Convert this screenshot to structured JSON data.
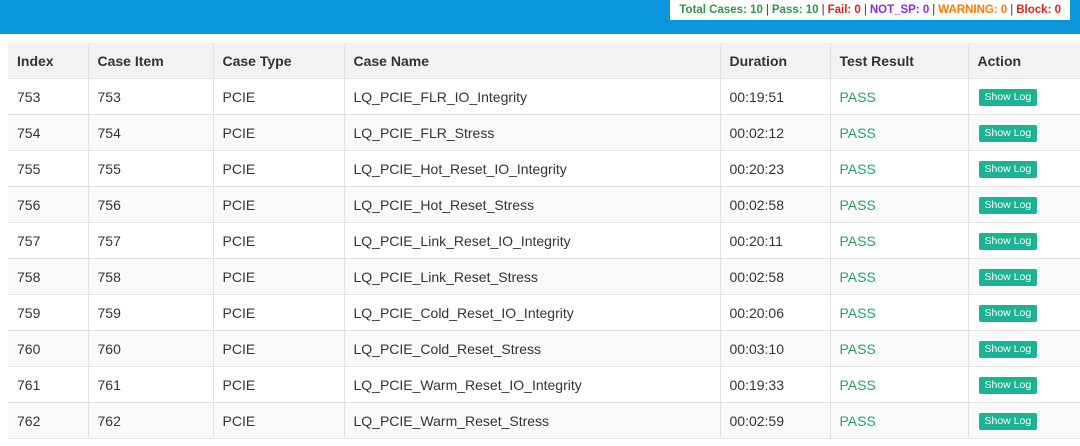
{
  "summary": {
    "total_label": "Total Cases: 10",
    "pass_label": "Pass: 10",
    "fail_label": "Fail: 0",
    "notsp_label": "NOT_SP: 0",
    "warning_label": "WARNING: 0",
    "block_label": "Block: 0",
    "separator": "|"
  },
  "table": {
    "headers": [
      "Index",
      "Case Item",
      "Case Type",
      "Case Name",
      "Duration",
      "Test Result",
      "Action"
    ],
    "rows": [
      {
        "index": "753",
        "case_item": "753",
        "case_type": "PCIE",
        "case_name": "LQ_PCIE_FLR_IO_Integrity",
        "duration": "00:19:51",
        "result": "PASS",
        "action": "Show Log"
      },
      {
        "index": "754",
        "case_item": "754",
        "case_type": "PCIE",
        "case_name": "LQ_PCIE_FLR_Stress",
        "duration": "00:02:12",
        "result": "PASS",
        "action": "Show Log"
      },
      {
        "index": "755",
        "case_item": "755",
        "case_type": "PCIE",
        "case_name": "LQ_PCIE_Hot_Reset_IO_Integrity",
        "duration": "00:20:23",
        "result": "PASS",
        "action": "Show Log"
      },
      {
        "index": "756",
        "case_item": "756",
        "case_type": "PCIE",
        "case_name": "LQ_PCIE_Hot_Reset_Stress",
        "duration": "00:02:58",
        "result": "PASS",
        "action": "Show Log"
      },
      {
        "index": "757",
        "case_item": "757",
        "case_type": "PCIE",
        "case_name": "LQ_PCIE_Link_Reset_IO_Integrity",
        "duration": "00:20:11",
        "result": "PASS",
        "action": "Show Log"
      },
      {
        "index": "758",
        "case_item": "758",
        "case_type": "PCIE",
        "case_name": "LQ_PCIE_Link_Reset_Stress",
        "duration": "00:02:58",
        "result": "PASS",
        "action": "Show Log"
      },
      {
        "index": "759",
        "case_item": "759",
        "case_type": "PCIE",
        "case_name": "LQ_PCIE_Cold_Reset_IO_Integrity",
        "duration": "00:20:06",
        "result": "PASS",
        "action": "Show Log"
      },
      {
        "index": "760",
        "case_item": "760",
        "case_type": "PCIE",
        "case_name": "LQ_PCIE_Cold_Reset_Stress",
        "duration": "00:03:10",
        "result": "PASS",
        "action": "Show Log"
      },
      {
        "index": "761",
        "case_item": "761",
        "case_type": "PCIE",
        "case_name": "LQ_PCIE_Warm_Reset_IO_Integrity",
        "duration": "00:19:33",
        "result": "PASS",
        "action": "Show Log"
      },
      {
        "index": "762",
        "case_item": "762",
        "case_type": "PCIE",
        "case_name": "LQ_PCIE_Warm_Reset_Stress",
        "duration": "00:02:59",
        "result": "PASS",
        "action": "Show Log"
      }
    ]
  },
  "colors": {
    "header_bar": "#0b96dd",
    "pass_text": "#1ea866",
    "show_log_button": "#1ab394"
  }
}
